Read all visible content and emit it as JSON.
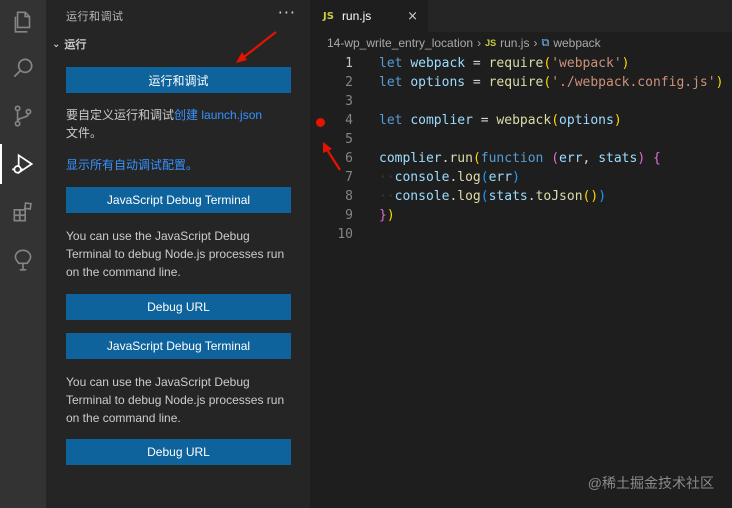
{
  "activity_bar": {
    "icons": [
      "explorer-icon",
      "search-icon",
      "source-control-icon",
      "run-debug-icon",
      "extensions-icon",
      "remote-icon"
    ]
  },
  "sidebar": {
    "title": "运行和调试",
    "more": "···",
    "section": "运行",
    "run_debug_button": "运行和调试",
    "custom_text_prefix": "要自定义运行和调试",
    "custom_link": "创建 launch.json",
    "custom_text_suffix": "文件。",
    "show_all_link": "显示所有自动调试配置。",
    "js_debug_terminal_button_1": "JavaScript Debug Terminal",
    "js_debug_text_1": "You can use the JavaScript Debug Terminal to debug Node.js processes run on the command line.",
    "debug_url_button_1": "Debug URL",
    "js_debug_terminal_button_2": "JavaScript Debug Terminal",
    "js_debug_text_2": "You can use the JavaScript Debug Terminal to debug Node.js processes run on the command line.",
    "debug_url_button_2": "Debug URL"
  },
  "editor": {
    "tab": {
      "lang": "JS",
      "name": "run.js",
      "close": "×"
    },
    "breadcrumb": {
      "folder": "14-wp_write_entry_location",
      "file_lang": "JS",
      "file": "run.js",
      "symbol": "webpack"
    },
    "lines": [
      {
        "n": "1",
        "tokens": [
          [
            "kw",
            "let"
          ],
          [
            "punc",
            " "
          ],
          [
            "var",
            "webpack"
          ],
          [
            "punc",
            " = "
          ],
          [
            "fn",
            "require"
          ],
          [
            "paren1",
            "("
          ],
          [
            "str",
            "'webpack'"
          ],
          [
            "paren1",
            ")"
          ]
        ]
      },
      {
        "n": "2",
        "tokens": [
          [
            "kw",
            "let"
          ],
          [
            "punc",
            " "
          ],
          [
            "var",
            "options"
          ],
          [
            "punc",
            " = "
          ],
          [
            "fn",
            "require"
          ],
          [
            "paren1",
            "("
          ],
          [
            "str",
            "'./webpack.config.js'"
          ],
          [
            "paren1",
            ")"
          ]
        ]
      },
      {
        "n": "3",
        "tokens": []
      },
      {
        "n": "4",
        "tokens": [
          [
            "kw",
            "let"
          ],
          [
            "punc",
            " "
          ],
          [
            "var",
            "complier"
          ],
          [
            "punc",
            " = "
          ],
          [
            "fn",
            "webpack"
          ],
          [
            "paren1",
            "("
          ],
          [
            "var",
            "options"
          ],
          [
            "paren1",
            ")"
          ]
        ]
      },
      {
        "n": "5",
        "tokens": []
      },
      {
        "n": "6",
        "tokens": [
          [
            "var",
            "complier"
          ],
          [
            "punc",
            "."
          ],
          [
            "fn",
            "run"
          ],
          [
            "paren1",
            "("
          ],
          [
            "kw",
            "function"
          ],
          [
            "punc",
            " "
          ],
          [
            "paren2",
            "("
          ],
          [
            "var",
            "err"
          ],
          [
            "punc",
            ", "
          ],
          [
            "var",
            "stats"
          ],
          [
            "paren2",
            ")"
          ],
          [
            "punc",
            " "
          ],
          [
            "paren2",
            "{"
          ]
        ]
      },
      {
        "n": "7",
        "tokens": [
          [
            "ws",
            "··"
          ],
          [
            "var",
            "console"
          ],
          [
            "punc",
            "."
          ],
          [
            "fn",
            "log"
          ],
          [
            "paren3",
            "("
          ],
          [
            "var",
            "err"
          ],
          [
            "paren3",
            ")"
          ]
        ]
      },
      {
        "n": "8",
        "tokens": [
          [
            "ws",
            "··"
          ],
          [
            "var",
            "console"
          ],
          [
            "punc",
            "."
          ],
          [
            "fn",
            "log"
          ],
          [
            "paren3",
            "("
          ],
          [
            "var",
            "stats"
          ],
          [
            "punc",
            "."
          ],
          [
            "fn",
            "toJson"
          ],
          [
            "paren1",
            "()"
          ],
          [
            "paren3",
            ")"
          ]
        ]
      },
      {
        "n": "9",
        "tokens": [
          [
            "paren2",
            "}"
          ],
          [
            "paren1",
            ")"
          ]
        ]
      },
      {
        "n": "10",
        "tokens": []
      }
    ]
  },
  "watermark": "@稀土掘金技术社区",
  "colors": {
    "accent_button": "#0e639c",
    "link": "#3794ff",
    "breakpoint": "#e51400",
    "annotation_arrow": "#e51400"
  }
}
